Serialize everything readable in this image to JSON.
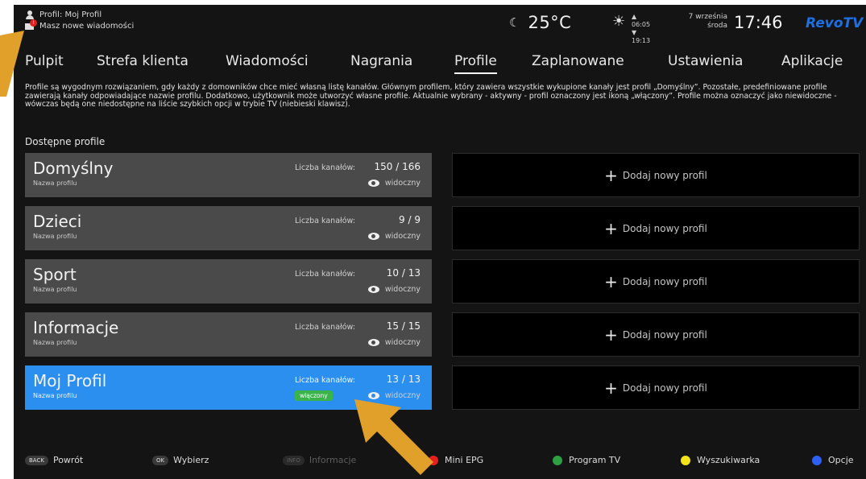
{
  "topbar": {
    "profile_line": "Profil: Moj Profil",
    "message_line": "Masz nowe wiadomości",
    "message_badge": "!",
    "temperature": "25°C",
    "sunrise": "06:05",
    "sunset": "19:13",
    "date_day": "7 września",
    "date_weekday": "środa",
    "clock": "17:46",
    "logo": "RevoTV"
  },
  "nav": {
    "items": [
      {
        "label": "Pulpit"
      },
      {
        "label": "Strefa klienta"
      },
      {
        "label": "Wiadomości"
      },
      {
        "label": "Nagrania"
      },
      {
        "label": "Profile"
      },
      {
        "label": "Zaplanowane"
      },
      {
        "label": "Ustawienia"
      },
      {
        "label": "Aplikacje"
      }
    ],
    "active": "Profile"
  },
  "description": "Profile są wygodnym rozwiązaniem, gdy każdy z domowników chce mieć własną listę kanałów. Głównym profilem, który zawiera wszystkie wykupione kanały jest profil „Domyślny”. Pozostałe, predefiniowane profile zawierają kanały odpowiadające nazwie profilu. Dodatkowo, użytkownik może utworzyć własne profile. Aktualnie wybrany - aktywny - profil oznaczony jest ikoną „włączony”. Profile można oznaczyć jako niewidoczne - wówczas będą one niedostępne na liście szybkich opcji w trybie TV (niebieski klawisz).",
  "section_title": "Dostępne profile",
  "profiles": [
    {
      "name": "Domyślny",
      "sub": "Nazwa profilu",
      "count_label": "Liczba kanałów:",
      "count": "150 / 166",
      "visibility": "widoczny"
    },
    {
      "name": "Dzieci",
      "sub": "Nazwa profilu",
      "count_label": "Liczba kanałów:",
      "count": "9 / 9",
      "visibility": "widoczny"
    },
    {
      "name": "Sport",
      "sub": "Nazwa profilu",
      "count_label": "Liczba kanałów:",
      "count": "10 / 13",
      "visibility": "widoczny"
    },
    {
      "name": "Informacje",
      "sub": "Nazwa profilu",
      "count_label": "Liczba kanałów:",
      "count": "15 / 15",
      "visibility": "widoczny"
    },
    {
      "name": "Moj Profil",
      "sub": "Nazwa profilu",
      "count_label": "Liczba kanałów:",
      "count": "13 / 13",
      "visibility": "widoczny",
      "active_badge": "włączony",
      "selected": true
    }
  ],
  "add_profile_label": "Dodaj nowy profil",
  "bottom": {
    "back": {
      "key": "BACK",
      "label": "Powrót"
    },
    "ok": {
      "key": "OK",
      "label": "Wybierz"
    },
    "info": {
      "key": "INFO",
      "label": "Informacje"
    },
    "red": {
      "label": "Mini EPG",
      "color": "#e81f1f"
    },
    "green": {
      "label": "Program TV",
      "color": "#2ea043"
    },
    "yellow": {
      "label": "Wyszukiwarka",
      "color": "#f2e31a"
    },
    "blue": {
      "label": "Opcje",
      "color": "#2f5ff0"
    }
  },
  "colors": {
    "selected_card": "#2b8fef",
    "card": "#4a4a4a",
    "arrow": "#e0a02a",
    "active_badge": "#3ab34a"
  }
}
